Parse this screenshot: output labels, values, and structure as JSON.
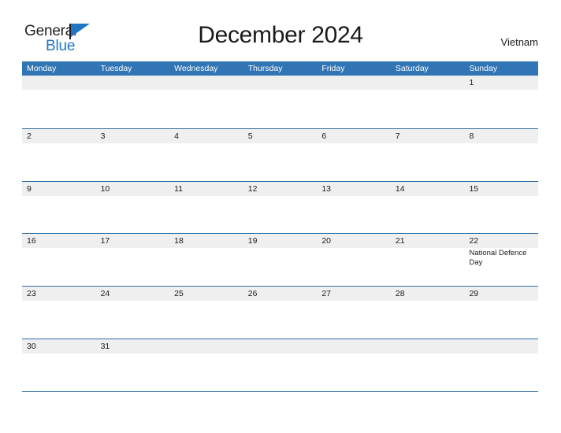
{
  "brand": {
    "name_part1": "General",
    "name_part2": "Blue",
    "flag_icon": "triangle-flag-icon",
    "accent_color": "#1f76c4"
  },
  "header": {
    "title": "December 2024",
    "country": "Vietnam"
  },
  "theme": {
    "header_blue": "#3175b5",
    "rule_blue": "#2e6da4",
    "band_gray": "#efefef",
    "text_dark": "#1a1a1a"
  },
  "calendar": {
    "month": "December",
    "year": "2024",
    "weekday_headers": [
      "Monday",
      "Tuesday",
      "Wednesday",
      "Thursday",
      "Friday",
      "Saturday",
      "Sunday"
    ],
    "weeks": [
      [
        {
          "day": ""
        },
        {
          "day": ""
        },
        {
          "day": ""
        },
        {
          "day": ""
        },
        {
          "day": ""
        },
        {
          "day": ""
        },
        {
          "day": "1"
        }
      ],
      [
        {
          "day": "2"
        },
        {
          "day": "3"
        },
        {
          "day": "4"
        },
        {
          "day": "5"
        },
        {
          "day": "6"
        },
        {
          "day": "7"
        },
        {
          "day": "8"
        }
      ],
      [
        {
          "day": "9"
        },
        {
          "day": "10"
        },
        {
          "day": "11"
        },
        {
          "day": "12"
        },
        {
          "day": "13"
        },
        {
          "day": "14"
        },
        {
          "day": "15"
        }
      ],
      [
        {
          "day": "16"
        },
        {
          "day": "17"
        },
        {
          "day": "18"
        },
        {
          "day": "19"
        },
        {
          "day": "20"
        },
        {
          "day": "21"
        },
        {
          "day": "22",
          "event": "National Defence Day"
        }
      ],
      [
        {
          "day": "23"
        },
        {
          "day": "24"
        },
        {
          "day": "25"
        },
        {
          "day": "26"
        },
        {
          "day": "27"
        },
        {
          "day": "28"
        },
        {
          "day": "29"
        }
      ],
      [
        {
          "day": "30"
        },
        {
          "day": "31"
        },
        {
          "day": ""
        },
        {
          "day": ""
        },
        {
          "day": ""
        },
        {
          "day": ""
        },
        {
          "day": ""
        }
      ]
    ]
  }
}
